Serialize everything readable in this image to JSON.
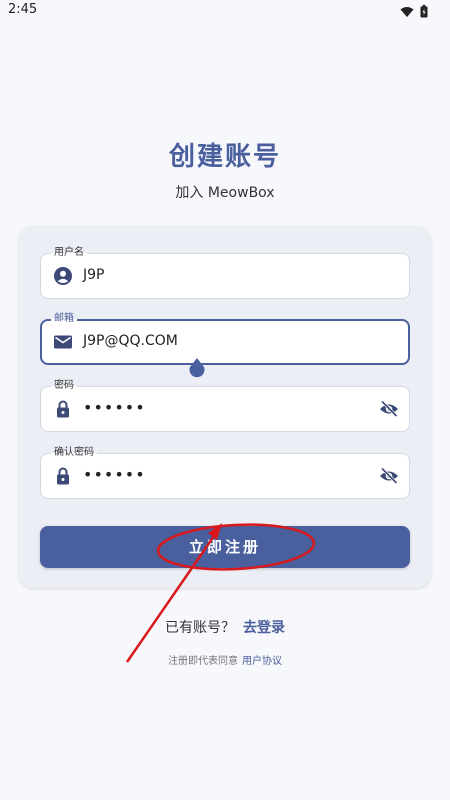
{
  "status_bar": {
    "time": "2:45"
  },
  "header": {
    "title": "创建账号",
    "subtitle": "加入 MeowBox"
  },
  "form": {
    "username": {
      "label": "用户名",
      "value": "J9P",
      "icon": "person-icon"
    },
    "email": {
      "label": "邮箱",
      "value": "J9P@QQ.COM",
      "icon": "mail-icon"
    },
    "password": {
      "label": "密码",
      "value": "••••••",
      "icon": "lock-icon"
    },
    "confirm_password": {
      "label": "确认密码",
      "value": "••••••",
      "icon": "lock-icon"
    },
    "submit_label": "立即注册"
  },
  "footer": {
    "has_account_text": "已有账号？",
    "login_link": "去登录",
    "terms_text": "注册即代表同意",
    "terms_link": "用户协议"
  },
  "colors": {
    "accent": "#4a5f9d",
    "background": "#f7f8fc",
    "card": "#eceef5",
    "annotation": "#d7191c"
  }
}
